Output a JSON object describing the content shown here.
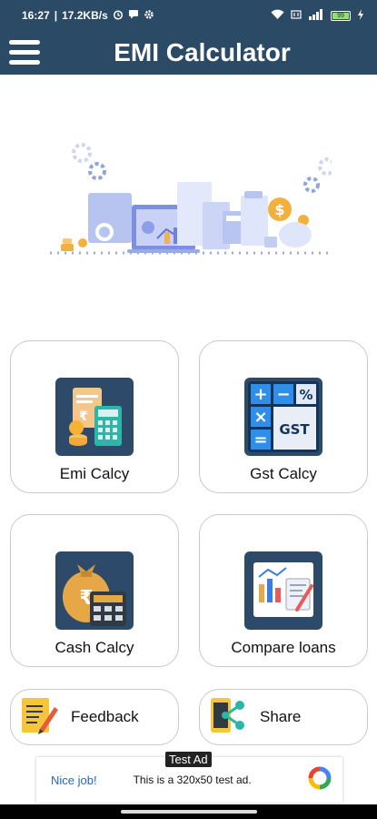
{
  "status_bar": {
    "time": "16:27",
    "speed": "17.2KB/s",
    "battery": "99"
  },
  "header": {
    "title": "EMI Calculator"
  },
  "cards": [
    {
      "label": "Emi Calcy",
      "icon": "emi-calculator-icon"
    },
    {
      "label": "Gst Calcy",
      "icon": "gst-calculator-icon"
    },
    {
      "label": "Cash Calcy",
      "icon": "cash-calculator-icon"
    },
    {
      "label": "Compare loans",
      "icon": "compare-loans-icon"
    }
  ],
  "actions": [
    {
      "label": "Feedback",
      "icon": "feedback-icon"
    },
    {
      "label": "Share",
      "icon": "share-icon"
    }
  ],
  "ad": {
    "badge": "Test Ad",
    "cta": "Nice job!",
    "text": "This is a 320x50 test ad."
  },
  "gst_tile": {
    "plus": "+",
    "minus": "−",
    "percent": "%",
    "times": "×",
    "equals": "=",
    "gst": "GST"
  },
  "emi_tile": {
    "rupee": "₹"
  },
  "cash_tile": {
    "rupee": "₹"
  },
  "colors": {
    "primary": "#2b4a66",
    "tile": "#2d4a6a",
    "ad_link": "#2167c9"
  }
}
